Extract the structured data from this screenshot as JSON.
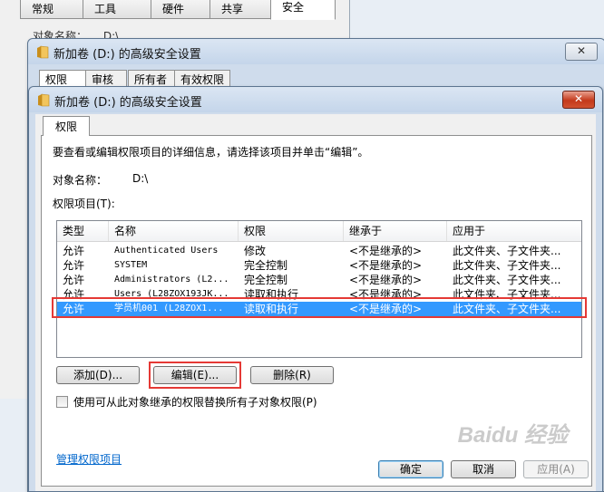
{
  "back_window": {
    "tabs": [
      "常规",
      "工具",
      "硬件",
      "共享",
      "安全"
    ],
    "object_name_label": "对象名称：",
    "object_name_value": "D:\\"
  },
  "mid_window": {
    "title": "新加卷 (D:) 的高级安全设置",
    "close": "✕",
    "tabs": [
      "权限",
      "审核",
      "所有者",
      "有效权限"
    ]
  },
  "dialog": {
    "title": "新加卷 (D:) 的高级安全设置",
    "close": "✕",
    "tab": "权限",
    "description": "要查看或编辑权限项目的详细信息，请选择该项目并单击“编辑”。",
    "object_name_label": "对象名称：",
    "object_name_value": "D:\\",
    "entries_label": "权限项目(T):",
    "columns": [
      "类型",
      "名称",
      "权限",
      "继承于",
      "应用于"
    ],
    "rows": [
      {
        "type": "允许",
        "name": "Authenticated Users",
        "permission": "修改",
        "inherited": "<不是继承的>",
        "applies": "此文件夹、子文件夹..."
      },
      {
        "type": "允许",
        "name": "SYSTEM",
        "permission": "完全控制",
        "inherited": "<不是继承的>",
        "applies": "此文件夹、子文件夹..."
      },
      {
        "type": "允许",
        "name": "Administrators (L2...",
        "permission": "完全控制",
        "inherited": "<不是继承的>",
        "applies": "此文件夹、子文件夹..."
      },
      {
        "type": "允许",
        "name": "Users (L28ZOX193JK...",
        "permission": "读取和执行",
        "inherited": "<不是继承的>",
        "applies": "此文件夹、子文件夹..."
      },
      {
        "type": "允许",
        "name": "学员机001 (L28ZOX1...",
        "permission": "读取和执行",
        "inherited": "<不是继承的>",
        "applies": "此文件夹、子文件夹..."
      }
    ],
    "buttons": {
      "add": "添加(D)...",
      "edit": "编辑(E)...",
      "remove": "删除(R)"
    },
    "checkbox_label": "使用可从此对象继承的权限替换所有子对象权限(P)",
    "link": "管理权限项目",
    "ok": "确定",
    "cancel": "取消",
    "apply": "应用(A)"
  },
  "watermark": "Baidu 经验",
  "colors": {
    "selection": "#3399ff",
    "highlight": "#e53935",
    "link": "#0066cc"
  }
}
